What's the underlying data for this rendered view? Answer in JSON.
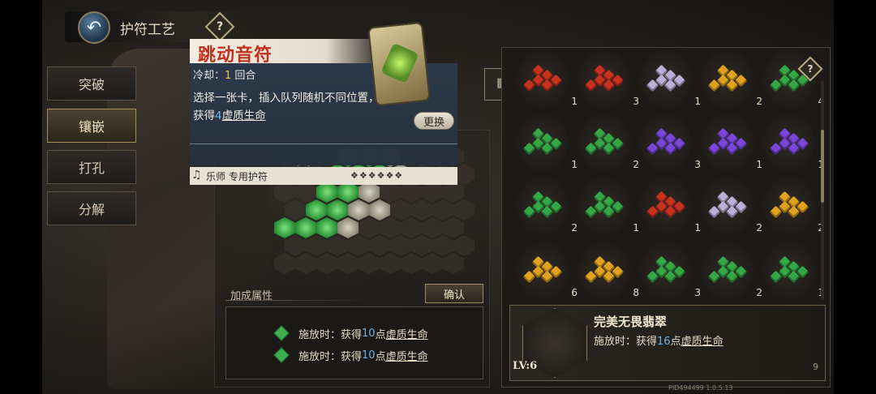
{
  "header": {
    "title": "护符工艺",
    "back_icon": "back-arrow-icon",
    "help_icon": "question-icon"
  },
  "tabs": [
    {
      "label": "突破",
      "active": false
    },
    {
      "label": "镶嵌",
      "active": true
    },
    {
      "label": "打孔",
      "active": false
    },
    {
      "label": "分解",
      "active": false
    }
  ],
  "charm": {
    "name": "跳动音符",
    "cooldown_label": "冷却：",
    "cooldown_value": "1",
    "cooldown_unit": " 回合",
    "desc_part1": "选择一张卡，插入队列随机不同位置，获得",
    "desc_value": "4",
    "desc_term": "虚质生命",
    "class_label": "乐师 专用护符",
    "swap_label": "更换"
  },
  "board": {
    "bonus_label": "加成属性",
    "confirm_label": "确认",
    "bonus_items": [
      {
        "prefix": "施放时：获得",
        "value": "10",
        "unit": "点",
        "term": "虚质生命"
      },
      {
        "prefix": "施放时：获得",
        "value": "10",
        "unit": "点",
        "term": "虚质生命"
      }
    ]
  },
  "grid": {
    "cells": [
      {
        "count": "1",
        "color": "#c8321e"
      },
      {
        "count": "3",
        "color": "#c8321e"
      },
      {
        "count": "1",
        "color": "#b9b0d8"
      },
      {
        "count": "2",
        "color": "#e0a21e"
      },
      {
        "count": "4",
        "color": "#35a746"
      },
      {
        "count": "1",
        "color": "#35a746"
      },
      {
        "count": "2",
        "color": "#35a746"
      },
      {
        "count": "3",
        "color": "#7a45d8"
      },
      {
        "count": "1",
        "color": "#7a45d8"
      },
      {
        "count": "1",
        "color": "#7a45d8"
      },
      {
        "count": "2",
        "color": "#35a746"
      },
      {
        "count": "1",
        "color": "#35a746"
      },
      {
        "count": "1",
        "color": "#c8321e"
      },
      {
        "count": "2",
        "color": "#b9b0d8"
      },
      {
        "count": "2",
        "color": "#e0a21e"
      },
      {
        "count": "6",
        "color": "#e0a21e"
      },
      {
        "count": "8",
        "color": "#e0a21e"
      },
      {
        "count": "3",
        "color": "#35a746"
      },
      {
        "count": "2",
        "color": "#35a746"
      },
      {
        "count": "1",
        "color": "#35a746"
      }
    ]
  },
  "detail": {
    "name": "完美无畏翡翠",
    "effect_prefix": "施放时：获得",
    "effect_value": "16",
    "effect_unit": "点",
    "effect_term": "虚质生命",
    "level": "LV:6",
    "page": "9"
  },
  "pid": "PID494499  1.0.5.13"
}
